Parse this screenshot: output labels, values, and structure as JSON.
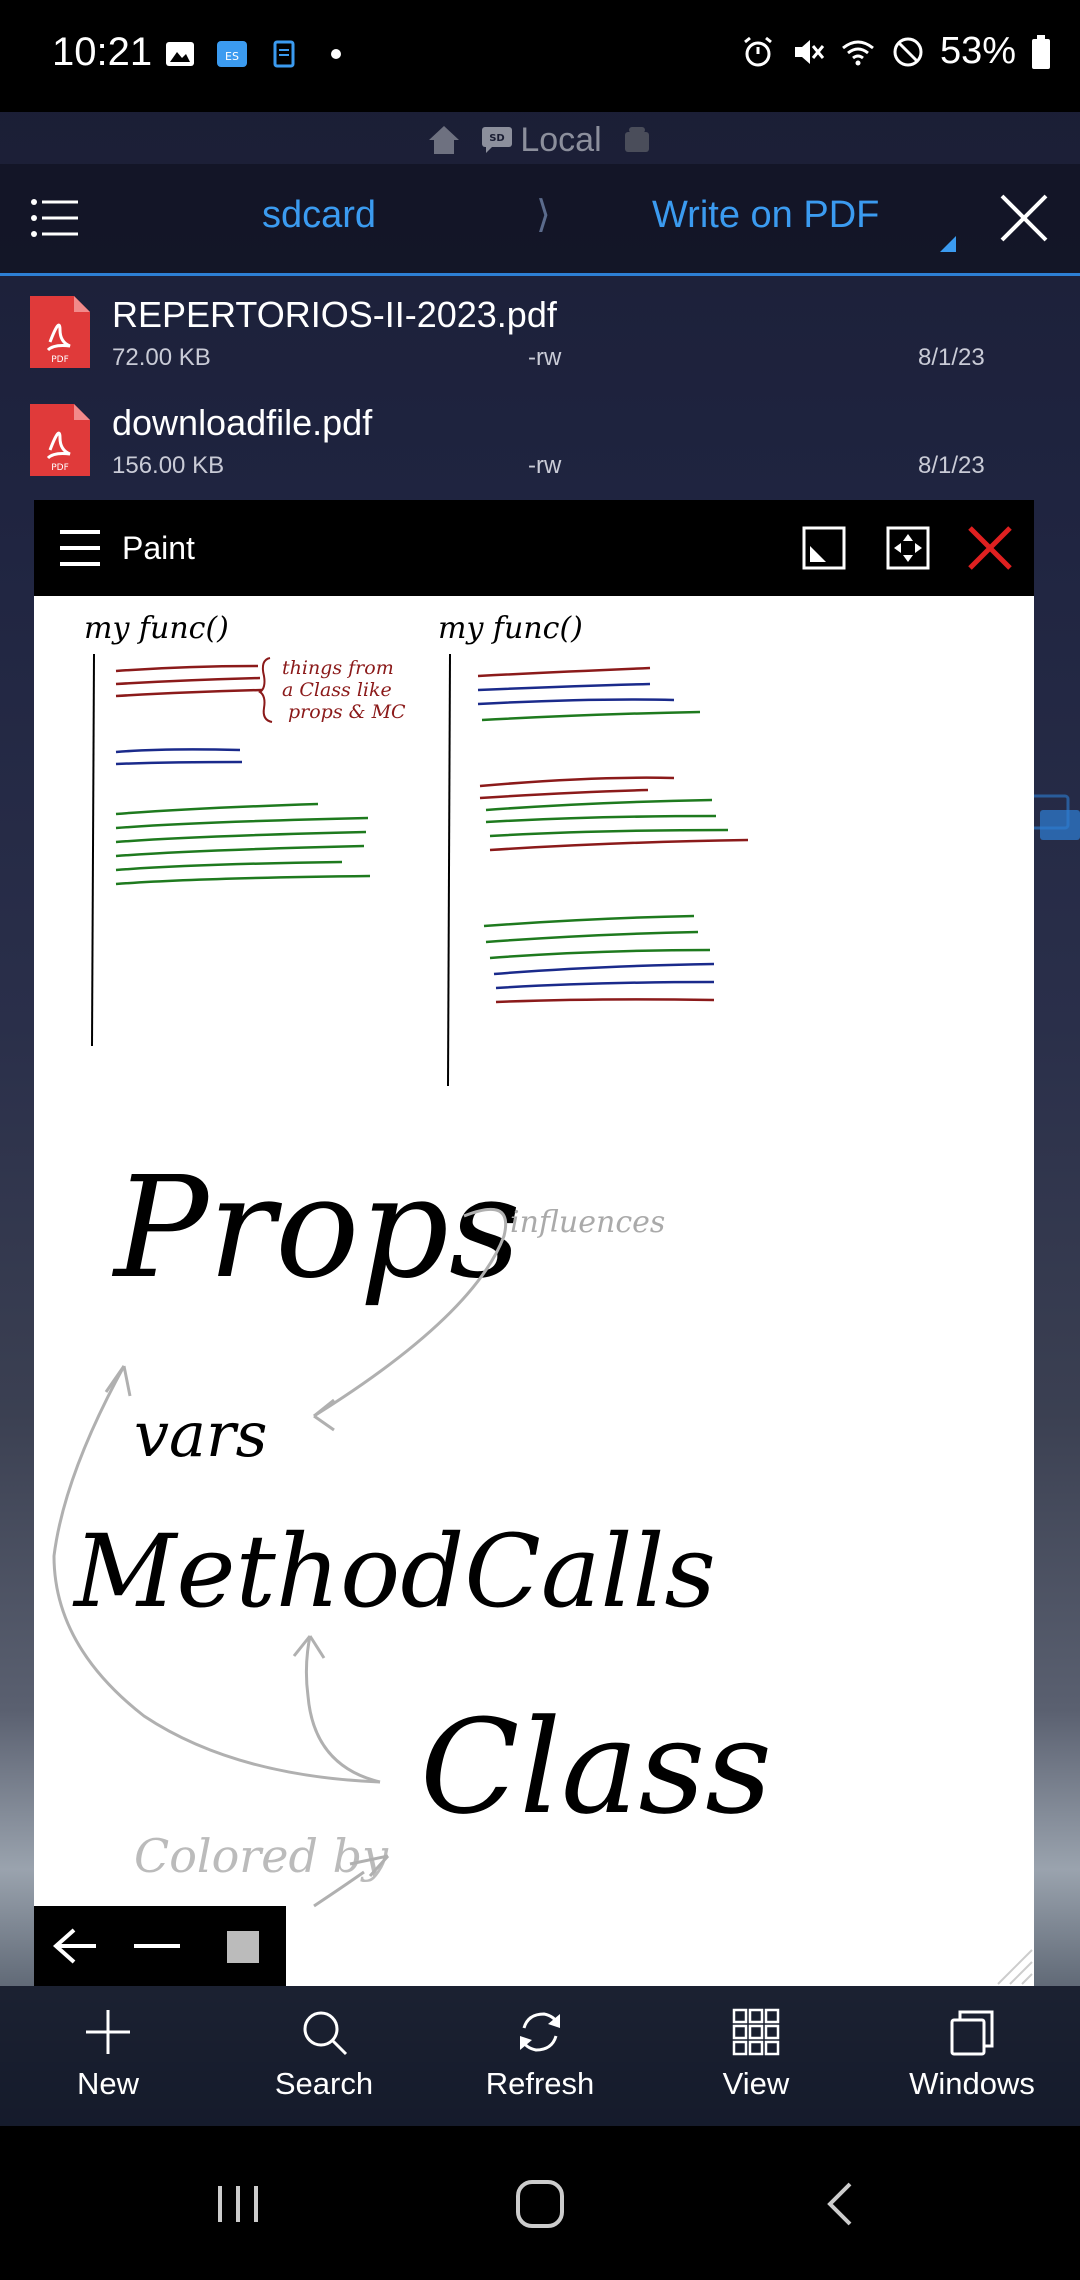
{
  "status_bar": {
    "time": "10:21",
    "battery": "53%",
    "left_icons": [
      "image-icon",
      "sd-card-icon",
      "clipboard-icon",
      "dot-icon"
    ],
    "right_icons": [
      "alarm-icon",
      "mute-icon",
      "wifi-icon",
      "do-not-disturb-icon",
      "battery-icon"
    ]
  },
  "top_nav": {
    "label": "Local",
    "icons": [
      "home-icon",
      "sd-chat-icon",
      "android-icon"
    ]
  },
  "path_bar": {
    "segment_1": "sdcard",
    "separator": "⟩",
    "segment_2": "Write on PDF"
  },
  "files": [
    {
      "name": "REPERTORIOS-II-2023.pdf",
      "size": "72.00 KB",
      "perm": "-rw",
      "date": "8/1/23"
    },
    {
      "name": "downloadfile.pdf",
      "size": "156.00 KB",
      "perm": "-rw",
      "date": "8/1/23"
    }
  ],
  "paint_window": {
    "title": "Paint",
    "canvas_text": {
      "func1": "my func()",
      "func2": "my func()",
      "note": "things from a Class like props & MC",
      "props": "Props",
      "vars": "vars",
      "method_calls": "MethodCalls",
      "class": "Class",
      "influences": "influences",
      "colored_by": "Colored by"
    }
  },
  "bottom_bar": {
    "items": [
      {
        "label": "New",
        "icon": "plus-icon"
      },
      {
        "label": "Search",
        "icon": "search-icon"
      },
      {
        "label": "Refresh",
        "icon": "refresh-icon"
      },
      {
        "label": "View",
        "icon": "grid-icon"
      },
      {
        "label": "Windows",
        "icon": "windows-icon"
      }
    ]
  },
  "colors": {
    "accent": "#3b9bf0",
    "pdf_red": "#e03a3a",
    "ink_red": "#8b1a1a",
    "ink_blue": "#1a2a8b",
    "ink_green": "#1e7a1e"
  }
}
